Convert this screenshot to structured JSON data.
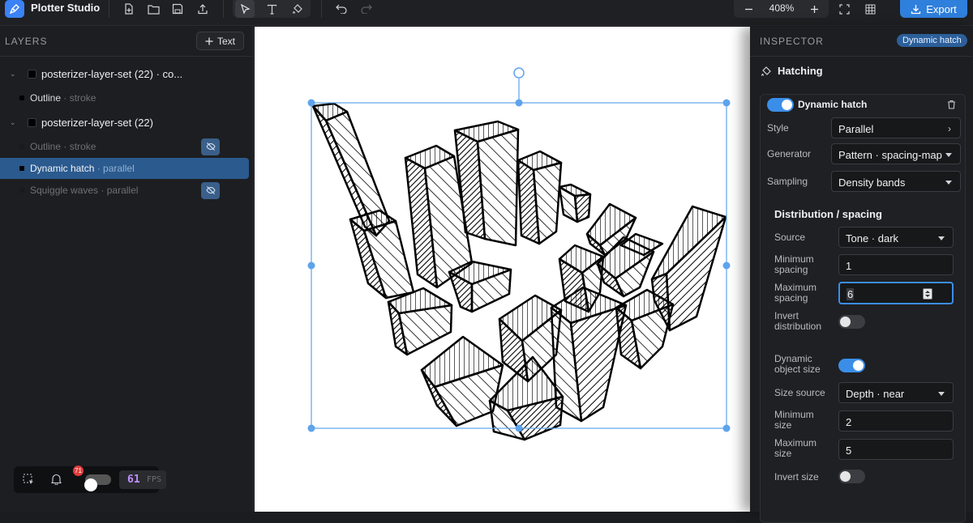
{
  "app": {
    "name": "Plotter Studio"
  },
  "toolbar": {
    "zoom": "408%",
    "export_label": "Export"
  },
  "layers": {
    "title": "LAYERS",
    "add_text_label": "Text",
    "items": [
      {
        "type": "group",
        "label": "posterizer-layer-set (22) · co...",
        "expanded": true
      },
      {
        "type": "layer",
        "label": "Outline",
        "sub": " · stroke",
        "hidden": false
      },
      {
        "type": "group",
        "label": "posterizer-layer-set (22)",
        "expanded": true
      },
      {
        "type": "layer",
        "label": "Outline",
        "sub": " · stroke",
        "hidden": true
      },
      {
        "type": "layer",
        "label": "Dynamic hatch",
        "sub": " · parallel",
        "selected": true
      },
      {
        "type": "layer",
        "label": "Squiggle waves",
        "sub": " · parallel",
        "hidden": true
      }
    ]
  },
  "status": {
    "notifications": "71",
    "fps": "61",
    "fps_unit": "FPS"
  },
  "inspector": {
    "title": "INSPECTOR",
    "badge": "Dynamic hatch",
    "section": "Hatching",
    "effect_name": "Dynamic hatch",
    "effect_enabled": true,
    "style_label": "Style",
    "style_value": "Parallel",
    "generator_label": "Generator",
    "generator_value": "Pattern · spacing-map",
    "sampling_label": "Sampling",
    "sampling_value": "Density bands",
    "distribution_title": "Distribution / spacing",
    "source_label": "Source",
    "source_value": "Tone · dark",
    "min_spacing_label_1": "Minimum",
    "min_spacing_label_2": "spacing",
    "min_spacing_value": "1",
    "max_spacing_label_1": "Maximum",
    "max_spacing_label_2": "spacing",
    "max_spacing_value": "6",
    "invert_dist_label_1": "Invert",
    "invert_dist_label_2": "distribution",
    "invert_distribution": false,
    "dyn_size_label_1": "Dynamic",
    "dyn_size_label_2": "object size",
    "dynamic_object_size": true,
    "size_source_label": "Size source",
    "size_source_value": "Depth · near",
    "min_size_label_1": "Minimum",
    "min_size_label_2": "size",
    "min_size_value": "2",
    "max_size_label_1": "Maximum",
    "max_size_label_2": "size",
    "max_size_value": "5",
    "invert_size_label": "Invert size",
    "invert_size": false
  },
  "colors": {
    "accent": "#3b8ee8",
    "selection": "#2b5a8e",
    "export": "#2f7fdc"
  }
}
